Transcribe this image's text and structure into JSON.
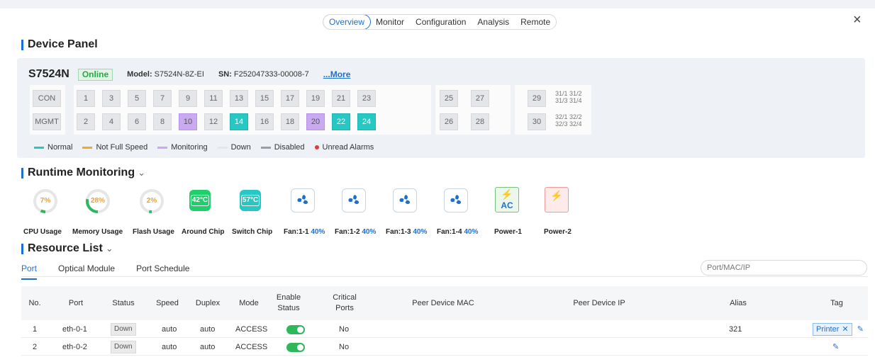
{
  "tabs": [
    "Overview",
    "Monitor",
    "Configuration",
    "Analysis",
    "Remote"
  ],
  "close_label": "×",
  "device_panel": {
    "title": "Device Panel",
    "name": "S7524N",
    "status": "Online",
    "model_label": "Model:",
    "model": "S7524N-8Z-EI",
    "sn_label": "SN:",
    "sn": "F252047333-00008-7",
    "more_label": "...More",
    "con_label": "CON",
    "mgmt_label": "MGMT",
    "top_ports": [
      "1",
      "3",
      "5",
      "7",
      "9",
      "11",
      "13",
      "15",
      "17",
      "19",
      "21",
      "23",
      "25",
      "27",
      "29"
    ],
    "bottom_ports": [
      "2",
      "4",
      "6",
      "8",
      "10",
      "12",
      "14",
      "16",
      "18",
      "20",
      "22",
      "24",
      "26",
      "28",
      "30"
    ],
    "split_top": [
      "31/1 31/2",
      "31/3 31/4"
    ],
    "split_bottom": [
      "32/1 32/2",
      "32/3 32/4"
    ],
    "legend": [
      "Normal",
      "Not Full Speed",
      "Monitoring",
      "Down",
      "Disabled",
      "Unread Alarms"
    ],
    "colors": {
      "normal": "#27c7c4",
      "not_full": "#f5a623",
      "monitoring": "#c9a9f0",
      "down": "#e4e6ea",
      "disabled": "#9a9ea6",
      "alarm": "#e53935"
    }
  },
  "runtime": {
    "title": "Runtime Monitoring",
    "cpu": {
      "label": "CPU Usage",
      "value": "7%",
      "fraction": 0.07
    },
    "memory": {
      "label": "Memory Usage",
      "value": "28%",
      "fraction": 0.28
    },
    "flash": {
      "label": "Flash Usage",
      "value": "2%",
      "fraction": 0.02
    },
    "around_chip": {
      "label": "Around Chip",
      "value": "42°C"
    },
    "switch_chip": {
      "label": "Switch Chip",
      "value": "57°C"
    },
    "fans": [
      {
        "label": "Fan:1-1",
        "pct": "40%"
      },
      {
        "label": "Fan:1-2",
        "pct": "40%"
      },
      {
        "label": "Fan:1-3",
        "pct": "40%"
      },
      {
        "label": "Fan:1-4",
        "pct": "40%"
      }
    ],
    "power1": {
      "label": "Power-1",
      "type": "AC"
    },
    "power2": {
      "label": "Power-2"
    }
  },
  "resource": {
    "title": "Resource List",
    "subtabs": [
      "Port",
      "Optical Module",
      "Port Schedule"
    ],
    "search_placeholder": "Port/MAC/IP",
    "columns": [
      "No.",
      "Port",
      "Status",
      "Speed",
      "Duplex",
      "Mode",
      "Enable Status",
      "Critical Ports",
      "Peer Device MAC",
      "Peer Device IP",
      "Alias",
      "Tag"
    ],
    "rows": [
      {
        "no": "1",
        "port": "eth-0-1",
        "status": "Down",
        "speed": "auto",
        "duplex": "auto",
        "mode": "ACCESS",
        "critical": "No",
        "alias": "321",
        "tag": "Printer"
      },
      {
        "no": "2",
        "port": "eth-0-2",
        "status": "Down",
        "speed": "auto",
        "duplex": "auto",
        "mode": "ACCESS",
        "critical": "No",
        "alias": "",
        "tag": ""
      }
    ]
  }
}
